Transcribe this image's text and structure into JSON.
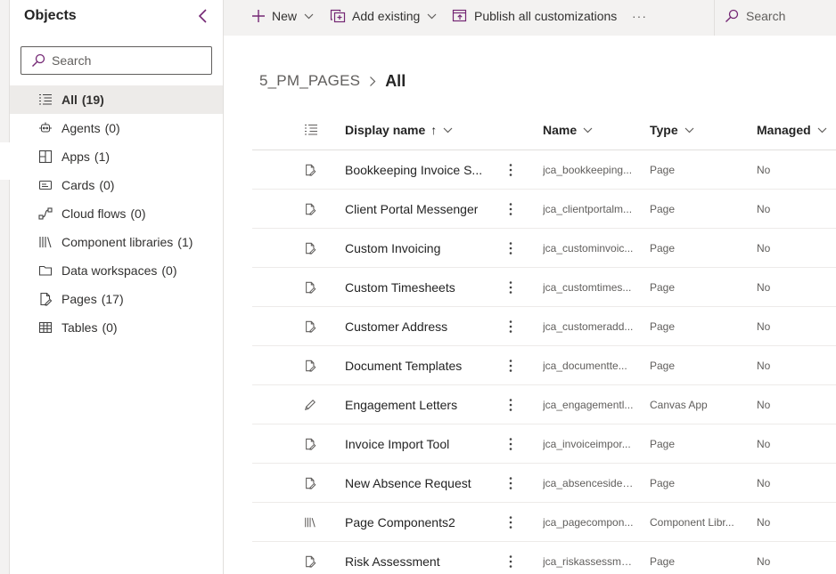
{
  "objects_panel": {
    "title": "Objects",
    "search_placeholder": "Search",
    "nav": [
      {
        "label": "All",
        "count": "(19)",
        "icon": "list-icon",
        "active": true
      },
      {
        "label": "Agents",
        "count": "(0)",
        "icon": "agent-icon"
      },
      {
        "label": "Apps",
        "count": "(1)",
        "icon": "apps-icon"
      },
      {
        "label": "Cards",
        "count": "(0)",
        "icon": "card-icon"
      },
      {
        "label": "Cloud flows",
        "count": "(0)",
        "icon": "flow-icon"
      },
      {
        "label": "Component libraries",
        "count": "(1)",
        "icon": "library-icon"
      },
      {
        "label": "Data workspaces",
        "count": "(0)",
        "icon": "folder-icon"
      },
      {
        "label": "Pages",
        "count": "(17)",
        "icon": "page-icon"
      },
      {
        "label": "Tables",
        "count": "(0)",
        "icon": "table-icon"
      }
    ]
  },
  "commandbar": {
    "new_label": "New",
    "add_existing_label": "Add existing",
    "publish_label": "Publish all customizations",
    "more_label": "···",
    "search_label": "Search"
  },
  "breadcrumb": {
    "solution": "5_PM_PAGES",
    "current": "All"
  },
  "table": {
    "columns": {
      "display_name": "Display name",
      "sort_indicator": "↑",
      "name": "Name",
      "type": "Type",
      "managed": "Managed"
    },
    "rows": [
      {
        "icon": "page-icon",
        "display": "Bookkeeping Invoice S...",
        "name": "jca_bookkeeping...",
        "type": "Page",
        "managed": "No"
      },
      {
        "icon": "page-icon",
        "display": "Client Portal Messenger",
        "name": "jca_clientportalm...",
        "type": "Page",
        "managed": "No"
      },
      {
        "icon": "page-icon",
        "display": "Custom Invoicing",
        "name": "jca_custominvoic...",
        "type": "Page",
        "managed": "No"
      },
      {
        "icon": "page-icon",
        "display": "Custom Timesheets",
        "name": "jca_customtimes...",
        "type": "Page",
        "managed": "No"
      },
      {
        "icon": "page-icon",
        "display": "Customer Address",
        "name": "jca_customeradd...",
        "type": "Page",
        "managed": "No"
      },
      {
        "icon": "page-icon",
        "display": "Document Templates",
        "name": "jca_documentte...",
        "type": "Page",
        "managed": "No"
      },
      {
        "icon": "canvas-app-icon",
        "display": "Engagement Letters",
        "name": "jca_engagementl...",
        "type": "Canvas App",
        "managed": "No"
      },
      {
        "icon": "page-icon",
        "display": "Invoice Import Tool",
        "name": "jca_invoiceimpor...",
        "type": "Page",
        "managed": "No"
      },
      {
        "icon": "page-icon",
        "display": "New Absence Request",
        "name": "jca_absencesidev...",
        "type": "Page",
        "managed": "No"
      },
      {
        "icon": "library-icon",
        "display": "Page Components2",
        "name": "jca_pagecompon...",
        "type": "Component Libr...",
        "managed": "No"
      },
      {
        "icon": "page-icon",
        "display": "Risk Assessment",
        "name": "jca_riskassessme...",
        "type": "Page",
        "managed": "No"
      }
    ]
  },
  "colors": {
    "accent": "#742774",
    "text": "#242424",
    "muted": "#605e5c",
    "panel_bg": "#f3f2f1",
    "selected_bg": "#edebe9"
  }
}
